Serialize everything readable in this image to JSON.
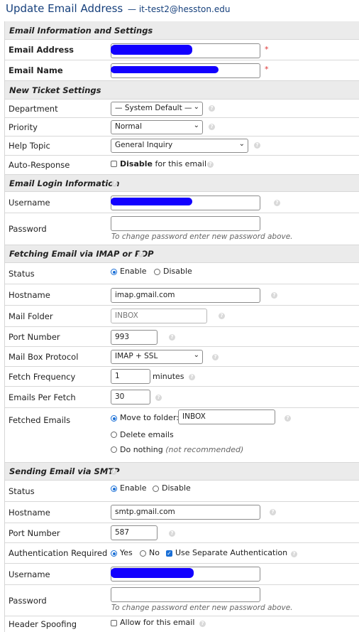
{
  "page": {
    "title": "Update Email Address",
    "subtitle": "— it-test2@hesston.edu"
  },
  "sections": {
    "email_info": "Email Information and Settings",
    "ticket": "New Ticket Settings",
    "login": "Email Login Information",
    "fetch": "Fetching Email via IMAP or POP",
    "smtp": "Sending Email via SMTP"
  },
  "email_info": {
    "address_label": "Email Address",
    "name_label": "Email Name",
    "required": "*"
  },
  "ticket": {
    "department_label": "Department",
    "department_value": "— System Default —",
    "priority_label": "Priority",
    "priority_value": "Normal",
    "help_topic_label": "Help Topic",
    "help_topic_value": "General Inquiry",
    "auto_response_label": "Auto-Response",
    "disable_bold": "Disable",
    "disable_rest": " for this email"
  },
  "login": {
    "username_label": "Username",
    "password_label": "Password",
    "password_hint": "To change password enter new password above."
  },
  "fetch": {
    "status_label": "Status",
    "enable": "Enable",
    "disable": "Disable",
    "hostname_label": "Hostname",
    "hostname_value": "imap.gmail.com",
    "folder_label": "Mail Folder",
    "folder_placeholder": "INBOX",
    "port_label": "Port Number",
    "port_value": "993",
    "protocol_label": "Mail Box Protocol",
    "protocol_value": "IMAP + SSL",
    "frequency_label": "Fetch Frequency",
    "frequency_value": "1",
    "frequency_unit": "minutes",
    "per_fetch_label": "Emails Per Fetch",
    "per_fetch_value": "30",
    "fetched_label": "Fetched Emails",
    "move_label": "Move to folder:",
    "move_value": "INBOX",
    "delete_label": "Delete emails",
    "nothing_label": "Do nothing",
    "nothing_note": "(not recommended)"
  },
  "smtp": {
    "status_label": "Status",
    "enable": "Enable",
    "disable": "Disable",
    "hostname_label": "Hostname",
    "hostname_value": "smtp.gmail.com",
    "port_label": "Port Number",
    "port_value": "587",
    "auth_label": "Authentication Required",
    "yes": "Yes",
    "no": "No",
    "separate_auth": "Use Separate Authentication",
    "username_label": "Username",
    "password_label": "Password",
    "password_hint": "To change password enter new password above.",
    "spoof_label": "Header Spoofing",
    "spoof_value": "Allow for this email"
  },
  "colors": {
    "redaction": "#1200ff",
    "title": "#16407c",
    "radio_accent": "#1a6fd6",
    "required": "#dd3333"
  },
  "icons": {
    "help": "help-circle-icon",
    "select": "chevron-down-icon"
  }
}
